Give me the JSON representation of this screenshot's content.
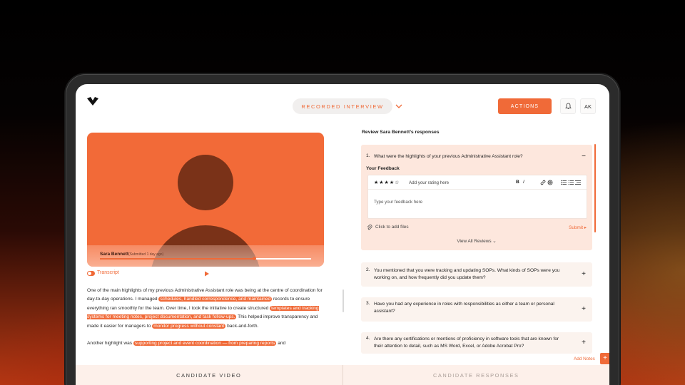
{
  "app": {
    "stage": "RECORDED INTERVIEW",
    "actions_label": "ACTIONS",
    "avatar_initials": "AK",
    "accent_color": "#f06a38"
  },
  "video": {
    "candidate_name": "Sara Bennett",
    "submitted": "(Submitted 1 day ago)",
    "progress": 0.73,
    "transcript_label": "Transcript"
  },
  "transcript": {
    "p1": [
      {
        "t": "One of the main highlights of my previous Administrative Assistant role was being at the centre of coordination for day-to-day operations. I managed ",
        "hl": false
      },
      {
        "t": "schedules, handled correspondence, and maintained",
        "hl": true
      },
      {
        "t": " records to ensure everything ran smoothly for the team. Over time, I took the initiative to create structured ",
        "hl": false
      },
      {
        "t": "templates and tracking systems for meeting notes, project documentation, and task follow-ups.",
        "hl": true
      },
      {
        "t": " This helped improve transparency and made it easier for managers to ",
        "hl": false
      },
      {
        "t": "monitor progress without constant",
        "hl": true
      },
      {
        "t": " back-and-forth.",
        "hl": false
      }
    ],
    "p2": [
      {
        "t": "Another highlight was ",
        "hl": false
      },
      {
        "t": "supporting project and event coordination — from preparing reports",
        "hl": true
      },
      {
        "t": " and",
        "hl": false
      }
    ]
  },
  "review": {
    "title": "Review Sara Bennett’s responses",
    "questions": [
      {
        "num": "1.",
        "text": "What were the highlights of your previous Administrative Assistant role?",
        "toggle": "−"
      },
      {
        "num": "2.",
        "text": "You mentioned that you were tracking and updating SOPs. What kinds of SOPs were you working on, and how frequently did you update them?",
        "toggle": "+"
      },
      {
        "num": "3.",
        "text": "Have you had any experience in roles with responsibilities as either a team or personal assistant?",
        "toggle": "+"
      },
      {
        "num": "4.",
        "text": "Are there any certifications or mentions of proficiency in software tools that are known for their attention to detail, such as MS Word, Excel, or Adobe Acrobat Pro?",
        "toggle": "+"
      }
    ],
    "feedback": {
      "label": "Your Feedback",
      "stars": "★★★★☆",
      "rating": 4,
      "rating_placeholder": "Add your rating here",
      "bold": "B",
      "italic": "I",
      "placeholder": "Type your feedback here",
      "attach_label": "Click to add files",
      "submit_label": "Submit ▸",
      "view_all_label": "View All Reviews ⌄"
    },
    "add_notes": "Add Notes",
    "add_notes_plus": "+"
  },
  "tabs": {
    "video": "CANDIDATE VIDEO",
    "responses": "CANDIDATE RESPONSES"
  }
}
